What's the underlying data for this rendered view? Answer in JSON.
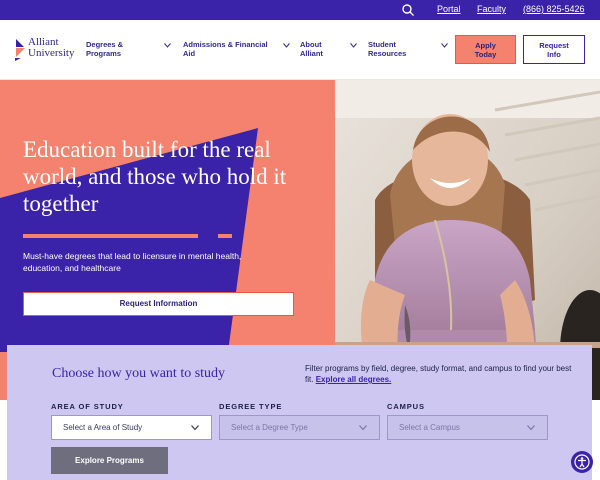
{
  "utility": {
    "search_icon": "search-icon",
    "portal": "Portal",
    "faculty": "Faculty",
    "phone": "(866) 825-5426"
  },
  "header": {
    "logo_line1": "Alliant",
    "logo_line2": "University",
    "nav": [
      {
        "line1": "Degrees &",
        "line2": "Programs"
      },
      {
        "line1": "Admissions & Financial",
        "line2": "Aid"
      },
      {
        "line1": "About",
        "line2": "Alliant"
      },
      {
        "line1": "Student",
        "line2": "Resources"
      }
    ],
    "apply_line1": "Apply",
    "apply_line2": "Today",
    "request_line1": "Request",
    "request_line2": "Info"
  },
  "hero": {
    "title": "Education built for the real world, and those who hold it together",
    "subtitle": "Must-have degrees that lead to licensure in mental health, education, and healthcare",
    "button": "Request Information"
  },
  "finder": {
    "title": "Choose how you want to study",
    "description": "Filter programs by field, degree, study format, and campus to find your best fit.",
    "explore_link": "Explore all degrees.",
    "area_label": "AREA OF STUDY",
    "area_placeholder": "Select a Area of Study",
    "degree_label": "DEGREE TYPE",
    "degree_placeholder": "Select a Degree Type",
    "campus_label": "CAMPUS",
    "campus_placeholder": "Select a Campus",
    "submit": "Explore Programs"
  },
  "colors": {
    "brand_purple": "#3a23a8",
    "coral": "#f5826e",
    "lavender": "#cdc7f1"
  },
  "accessibility_icon": "accessibility-icon"
}
